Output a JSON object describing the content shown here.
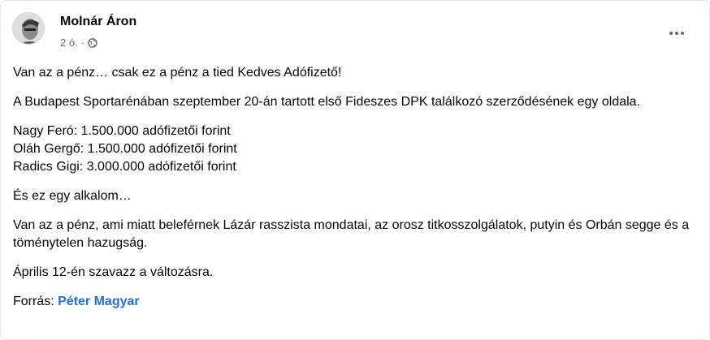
{
  "post": {
    "author": "Molnár Áron",
    "time": "2 ó.",
    "separator": "·",
    "privacy_icon": "globe-icon",
    "more_icon": "more-dots-icon",
    "paragraphs": {
      "p1": "Van az a pénz… csak ez a pénz a tied Kedves Adófizető!",
      "p2": "A Budapest Sportarénában szeptember 20-án tartott első Fideszes DPK találkozó szerződésének egy oldala.",
      "l1": "Nagy Feró: 1.500.000 adófizetői forint",
      "l2": "Oláh Gergő: 1.500.000 adófizetői forint",
      "l3": "Radics Gigi: 3.000.000 adófizetői forint",
      "p4": "És ez egy alkalom…",
      "p5": "Van az a pénz, ami miatt beleférnek Lázár rasszista mondatai, az orosz titkosszolgálatok, putyin és Orbán segge és a töménytelen hazugság.",
      "p6": "Április 12-én szavazz a változásra."
    },
    "source_label": "Forrás: ",
    "source_link": "Péter Magyar"
  },
  "colors": {
    "link": "#216fdb",
    "meta": "#65676b",
    "border": "#e4e6eb"
  }
}
